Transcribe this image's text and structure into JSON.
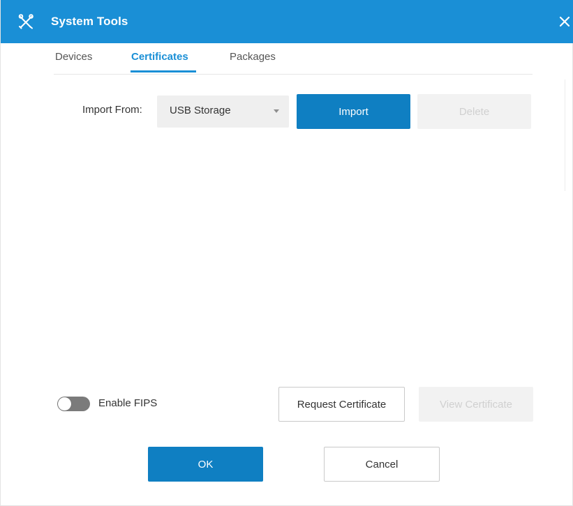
{
  "window": {
    "title": "System Tools",
    "app_icon": "tools-icon",
    "close_icon": "close-icon",
    "accent_color": "#1a8fd6"
  },
  "tabs": {
    "items": [
      {
        "label": "Devices",
        "active": false
      },
      {
        "label": "Certificates",
        "active": true
      },
      {
        "label": "Packages",
        "active": false
      }
    ]
  },
  "import": {
    "label": "Import From:",
    "source_value": "USB Storage",
    "import_button": "Import",
    "delete_button": "Delete"
  },
  "fips": {
    "toggle_label": "Enable FIPS",
    "enabled": false
  },
  "certificate_actions": {
    "request_button": "Request Certificate",
    "view_button": "View Certificate"
  },
  "dialog_buttons": {
    "ok": "OK",
    "cancel": "Cancel"
  }
}
